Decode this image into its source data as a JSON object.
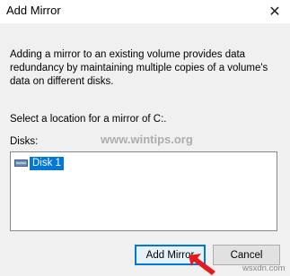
{
  "window": {
    "title": "Add Mirror",
    "close_glyph": "✕"
  },
  "description": "Adding a mirror to an existing volume provides data redundancy by maintaining multiple copies of a volume's data on different disks.",
  "select_label": "Select a location for a mirror of C:.",
  "disks_label": "Disks:",
  "disks": {
    "items": [
      {
        "label": "Disk 1",
        "icon": "disk-drive-icon",
        "selected": true
      }
    ]
  },
  "buttons": {
    "add_mirror": "Add Mirror",
    "cancel": "Cancel"
  },
  "watermark": "www.wintips.org",
  "brand": "wsxdn.com",
  "colors": {
    "selection": "#0078d7",
    "dialog_bg": "#f0f0f0",
    "arrow": "#e31b1b"
  }
}
